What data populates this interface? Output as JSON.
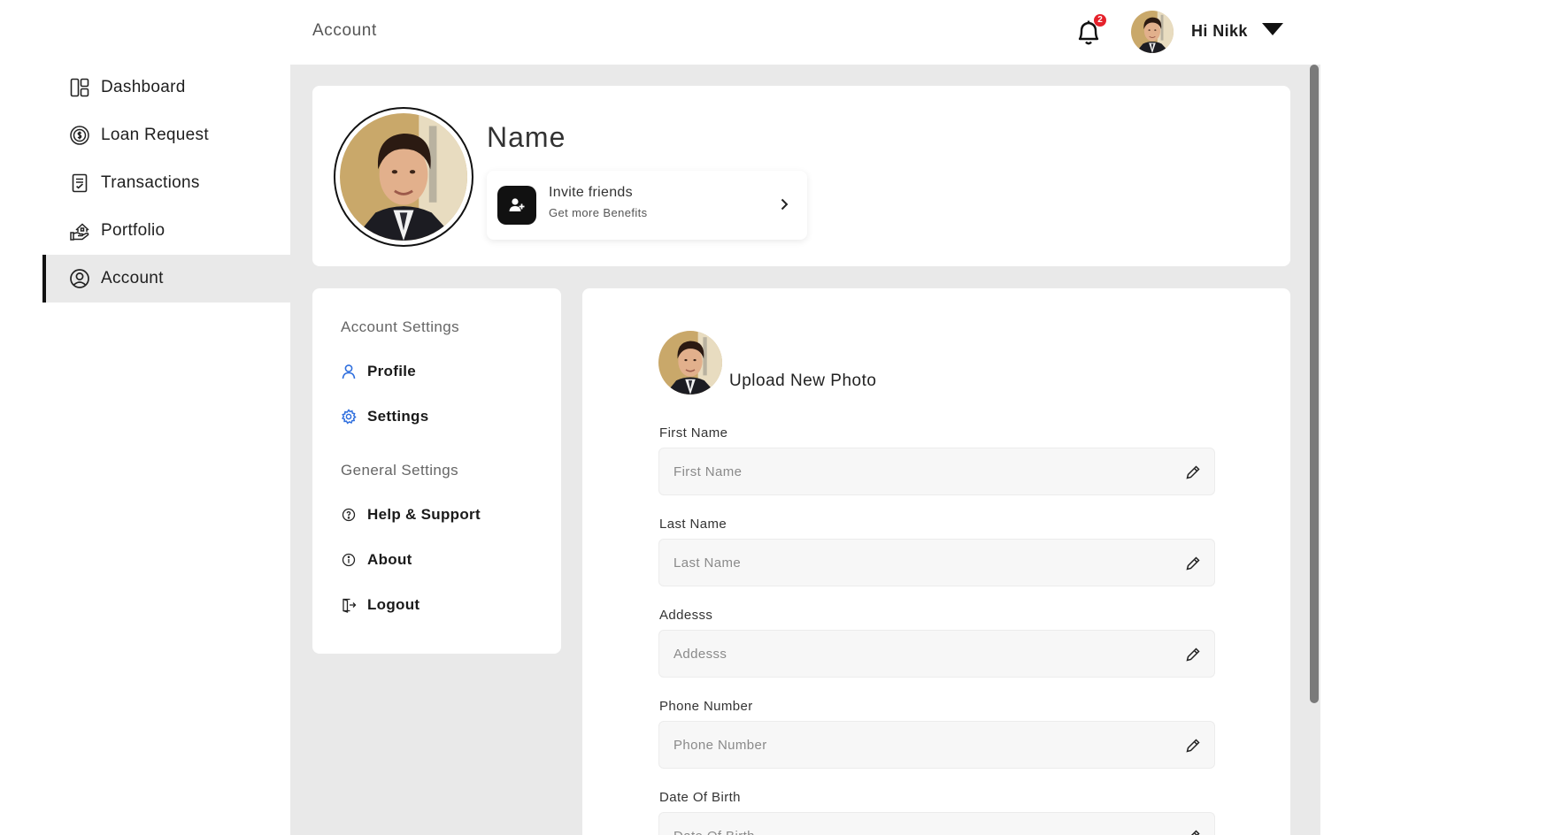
{
  "sidebar": {
    "items": [
      {
        "label": "Dashboard",
        "icon": "dashboard-icon"
      },
      {
        "label": "Loan Request",
        "icon": "loan-coin-icon"
      },
      {
        "label": "Transactions",
        "icon": "receipt-icon"
      },
      {
        "label": "Portfolio",
        "icon": "portfolio-hand-icon"
      },
      {
        "label": "Account",
        "icon": "user-circle-icon",
        "active": true
      }
    ]
  },
  "header": {
    "title": "Account",
    "notification_count": "2",
    "greeting": "Hi Nikk"
  },
  "profile": {
    "name": "Name",
    "invite_title": "Invite friends",
    "invite_subtitle": "Get more Benefits"
  },
  "settings_menu": {
    "account_heading": "Account Settings",
    "profile_label": "Profile",
    "settings_label": "Settings",
    "general_heading": "General Settings",
    "help_label": "Help & Support",
    "about_label": "About",
    "logout_label": "Logout"
  },
  "form": {
    "upload_label": "Upload New Photo",
    "first_name_label": "First Name",
    "first_name_placeholder": "First Name",
    "last_name_label": "Last Name",
    "last_name_placeholder": "Last Name",
    "address_label": "Addesss",
    "address_placeholder": "Addesss",
    "phone_label": "Phone Number",
    "phone_placeholder": "Phone Number",
    "dob_label": "Date Of Birth",
    "dob_placeholder": "Date Of Birth"
  },
  "colors": {
    "accent": "#2f6fde",
    "badge": "#e5212b",
    "main_bg": "#e9e9e9"
  }
}
